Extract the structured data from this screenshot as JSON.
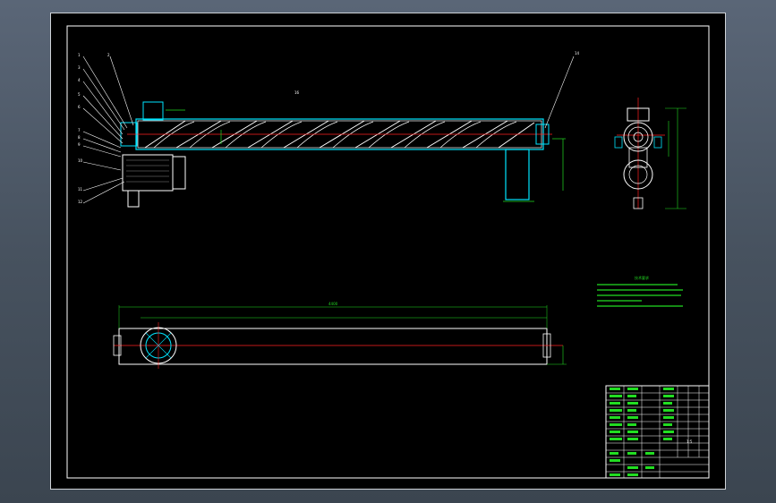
{
  "drawing": {
    "sheet_number": "16",
    "callout_labels": [
      "1",
      "2",
      "3",
      "4",
      "5",
      "6",
      "7",
      "8",
      "9",
      "10",
      "11",
      "12",
      "13",
      "14",
      "15"
    ],
    "right_callout": "14",
    "tech_requirements_title": "技术要求",
    "tech_requirements_lines": [
      "1.",
      "2.",
      "3.",
      "4.",
      "5."
    ],
    "overall_dimension": "4400",
    "title_block": {
      "scale": "1:5"
    }
  },
  "colors": {
    "outline": "#ffffff",
    "centerline": "#ff2020",
    "dimension": "#22dd22",
    "section": "#00ffff",
    "hidden": "#ffffff",
    "frame": "#ffffff"
  }
}
